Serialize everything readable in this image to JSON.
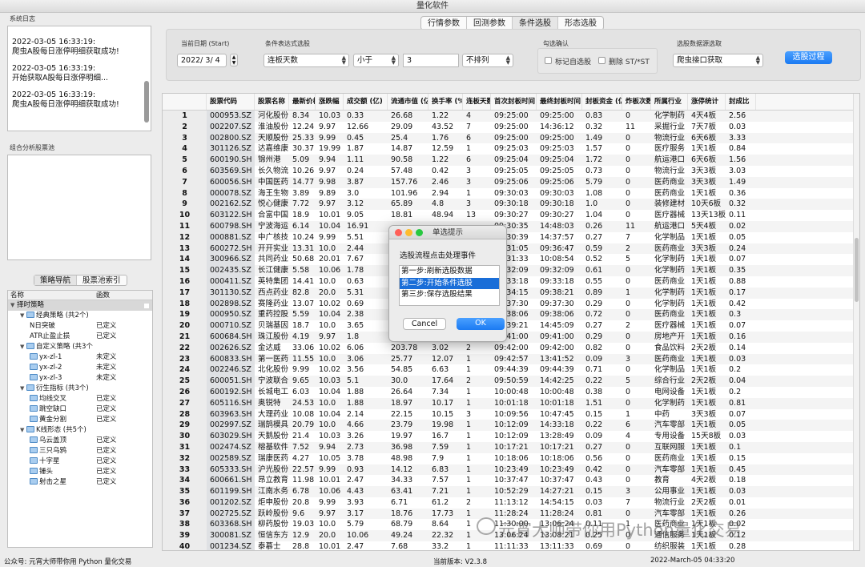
{
  "window": {
    "title": "量化软件"
  },
  "tabs": [
    {
      "label": "行情参数"
    },
    {
      "label": "回测参数"
    },
    {
      "label": "条件选股"
    },
    {
      "label": "形态选股"
    }
  ],
  "system_log": {
    "title": "系统日志",
    "entries": [
      {
        "time": "2022-03-05 16:33:19:",
        "text": "爬虫A股每日涨停明细获取成功!"
      },
      {
        "time": "2022-03-05 16:33:19:",
        "text": "开始获取A股每日涨停明细..."
      },
      {
        "time": "2022-03-05 16:33:19:",
        "text": "爬虫A股每日涨停明细获取成功!"
      }
    ]
  },
  "pool": {
    "title": "组合分析股票池"
  },
  "nav": {
    "tabs": [
      "策略导航",
      "股票池索引"
    ],
    "col_name": "名称",
    "col_func": "函数",
    "items": [
      {
        "label": "择时策略",
        "level": 0,
        "value": "",
        "folder": false,
        "sel": true
      },
      {
        "label": "经典策略 (共2个)",
        "level": 1,
        "value": "",
        "folder": true
      },
      {
        "label": "N日突破",
        "level": 2,
        "value": "已定义",
        "folder": false
      },
      {
        "label": "ATR止盈止损",
        "level": 2,
        "value": "已定义",
        "folder": false
      },
      {
        "label": "自定义策略 (共3个",
        "level": 1,
        "value": "",
        "folder": true
      },
      {
        "label": "yx-zl-1",
        "level": 2,
        "value": "未定义",
        "folder": true
      },
      {
        "label": "yx-zl-2",
        "level": 2,
        "value": "未定义",
        "folder": true
      },
      {
        "label": "yx-zl-3",
        "level": 2,
        "value": "未定义",
        "folder": true
      },
      {
        "label": "衍生指标 (共3个)",
        "level": 1,
        "value": "",
        "folder": true
      },
      {
        "label": "均线交叉",
        "level": 2,
        "value": "已定义",
        "folder": true
      },
      {
        "label": "跳空缺口",
        "level": 2,
        "value": "已定义",
        "folder": true
      },
      {
        "label": "黄金分割",
        "level": 2,
        "value": "已定义",
        "folder": true
      },
      {
        "label": "K线形态 (共5个)",
        "level": 1,
        "value": "",
        "folder": true
      },
      {
        "label": "乌云盖顶",
        "level": 2,
        "value": "已定义",
        "folder": true
      },
      {
        "label": "三只乌鸦",
        "level": 2,
        "value": "已定义",
        "folder": true
      },
      {
        "label": "十字星",
        "level": 2,
        "value": "已定义",
        "folder": true
      },
      {
        "label": "锤头",
        "level": 2,
        "value": "已定义",
        "folder": true
      },
      {
        "label": "射击之星",
        "level": 2,
        "value": "已定义",
        "folder": true
      }
    ]
  },
  "filter": {
    "date_label": "当前日期 (Start)",
    "date_value": "2022/  3/  4",
    "cond_label": "条件表达式选股",
    "cond_field": "连板天数",
    "cond_op": "小于",
    "cond_value": "3",
    "cond_sort": "不排列",
    "check_label": "勾选确认",
    "check1": "标记自选股",
    "check2": "删除 ST/*ST",
    "source_label": "选股数据源选取",
    "source_value": "爬虫接口获取",
    "button": "选股过程"
  },
  "table": {
    "headers": [
      "",
      "股票代码",
      "股票名称",
      "最新价格",
      "涨跌幅",
      "成交额 (亿)",
      "流通市值 (亿)",
      "换手率 (%)",
      "连板天数",
      "首次封板时间",
      "最终封板时间",
      "封板资金 (亿)",
      "炸板次数",
      "所属行业",
      "涨停统计",
      "封成比"
    ],
    "rows": [
      [
        "1",
        "000953.SZ",
        "河化股份",
        "8.34",
        "10.03",
        "0.33",
        "26.68",
        "1.22",
        "4",
        "09:25:00",
        "09:25:00",
        "0.83",
        "0",
        "化学制药",
        "4天4板",
        "2.56"
      ],
      [
        "2",
        "002207.SZ",
        "淮油股份",
        "12.24",
        "9.97",
        "12.66",
        "29.09",
        "43.52",
        "7",
        "09:25:00",
        "14:36:12",
        "0.32",
        "11",
        "采掘行业",
        "7天7板",
        "0.03"
      ],
      [
        "3",
        "002800.SZ",
        "天顺股份",
        "25.33",
        "9.99",
        "0.45",
        "25.4",
        "1.76",
        "6",
        "09:25:00",
        "09:25:00",
        "1.49",
        "0",
        "物流行业",
        "6天6板",
        "3.33"
      ],
      [
        "4",
        "301126.SZ",
        "达嘉维康",
        "30.37",
        "19.99",
        "1.87",
        "14.87",
        "12.59",
        "1",
        "09:25:03",
        "09:25:03",
        "1.57",
        "0",
        "医疗服务",
        "1天1板",
        "0.84"
      ],
      [
        "5",
        "600190.SH",
        "锦州港",
        "5.09",
        "9.94",
        "1.11",
        "90.58",
        "1.22",
        "6",
        "09:25:04",
        "09:25:04",
        "1.72",
        "0",
        "航运港口",
        "6天6板",
        "1.56"
      ],
      [
        "6",
        "603569.SH",
        "长久物流",
        "10.26",
        "9.97",
        "0.24",
        "57.48",
        "0.42",
        "3",
        "09:25:05",
        "09:25:05",
        "0.73",
        "0",
        "物流行业",
        "3天3板",
        "3.03"
      ],
      [
        "7",
        "600056.SH",
        "中国医药",
        "14.77",
        "9.98",
        "3.87",
        "157.76",
        "2.46",
        "3",
        "09:25:06",
        "09:25:06",
        "5.79",
        "0",
        "医药商业",
        "3天3板",
        "1.49"
      ],
      [
        "8",
        "000078.SZ",
        "海王生物",
        "3.89",
        "9.89",
        "3.0",
        "101.96",
        "2.94",
        "1",
        "09:30:03",
        "09:30:03",
        "1.08",
        "0",
        "医药商业",
        "1天1板",
        "0.36"
      ],
      [
        "9",
        "002162.SZ",
        "悦心健康",
        "7.72",
        "9.97",
        "3.12",
        "65.89",
        "4.8",
        "3",
        "09:30:18",
        "09:30:18",
        "1.0",
        "0",
        "装修建材",
        "10天6板",
        "0.32"
      ],
      [
        "10",
        "603122.SH",
        "合富中国",
        "18.9",
        "10.01",
        "9.05",
        "18.81",
        "48.94",
        "13",
        "09:30:27",
        "09:30:27",
        "1.04",
        "0",
        "医疗器械",
        "13天13板",
        "0.11"
      ],
      [
        "11",
        "600798.SH",
        "宁波海运",
        "6.14",
        "10.04",
        "16.91",
        "",
        "",
        "",
        "09:30:35",
        "14:48:03",
        "0.26",
        "11",
        "航运港口",
        "5天4板",
        "0.02"
      ],
      [
        "12",
        "000881.SZ",
        "中广核技",
        "10.24",
        "9.99",
        "5.51",
        "",
        "",
        "",
        "09:30:39",
        "14:37:57",
        "0.27",
        "7",
        "化学制品",
        "1天1板",
        "0.05"
      ],
      [
        "13",
        "600272.SH",
        "开开实业",
        "13.31",
        "10.0",
        "2.44",
        "",
        "",
        "",
        "09:31:05",
        "09:36:47",
        "0.59",
        "2",
        "医药商业",
        "3天3板",
        "0.24"
      ],
      [
        "14",
        "300966.SZ",
        "共同药业",
        "50.68",
        "20.01",
        "7.67",
        "",
        "",
        "",
        "09:31:33",
        "10:08:54",
        "0.52",
        "5",
        "化学制药",
        "1天1板",
        "0.07"
      ],
      [
        "15",
        "002435.SZ",
        "长江健康",
        "5.58",
        "10.06",
        "1.78",
        "",
        "",
        "",
        "09:32:09",
        "09:32:09",
        "0.61",
        "0",
        "化学制药",
        "1天1板",
        "0.35"
      ],
      [
        "16",
        "000411.SZ",
        "英特集团",
        "14.41",
        "10.0",
        "0.63",
        "",
        "",
        "",
        "09:33:18",
        "09:33:18",
        "0.55",
        "0",
        "医药商业",
        "1天1板",
        "0.88"
      ],
      [
        "17",
        "301130.SZ",
        "西点药业",
        "82.8",
        "20.0",
        "5.31",
        "",
        "",
        "",
        "09:34:15",
        "09:38:21",
        "0.89",
        "1",
        "化学制药",
        "1天1板",
        "0.17"
      ],
      [
        "18",
        "002898.SZ",
        "赛隆药业",
        "13.07",
        "10.02",
        "0.69",
        "",
        "",
        "",
        "09:37:30",
        "09:37:30",
        "0.29",
        "0",
        "化学制药",
        "1天1板",
        "0.42"
      ],
      [
        "19",
        "000950.SZ",
        "重药控股",
        "5.59",
        "10.04",
        "2.38",
        "",
        "",
        "",
        "09:38:06",
        "09:38:06",
        "0.72",
        "0",
        "医药商业",
        "1天1板",
        "0.3"
      ],
      [
        "20",
        "000710.SZ",
        "贝瑞基因",
        "18.7",
        "10.0",
        "3.65",
        "",
        "",
        "",
        "09:39:21",
        "14:45:09",
        "0.27",
        "2",
        "医疗器械",
        "1天1板",
        "0.07"
      ],
      [
        "21",
        "600684.SH",
        "珠江股份",
        "4.19",
        "9.97",
        "1.8",
        "",
        "",
        "",
        "09:41:00",
        "09:41:00",
        "0.29",
        "0",
        "房地产开",
        "1天1板",
        "0.16"
      ],
      [
        "22",
        "002626.SZ",
        "金达威",
        "33.06",
        "10.02",
        "6.06",
        "203.78",
        "3.02",
        "2",
        "09:42:00",
        "09:42:00",
        "0.82",
        "0",
        "食品饮料",
        "2天2板",
        "0.14"
      ],
      [
        "23",
        "600833.SH",
        "第一医药",
        "11.55",
        "10.0",
        "3.06",
        "25.77",
        "12.07",
        "1",
        "09:42:57",
        "13:41:52",
        "0.09",
        "3",
        "医药商业",
        "1天1板",
        "0.03"
      ],
      [
        "24",
        "002246.SZ",
        "北化股份",
        "9.99",
        "10.02",
        "3.56",
        "54.85",
        "6.63",
        "1",
        "09:44:39",
        "09:44:39",
        "0.71",
        "0",
        "化学制品",
        "1天1板",
        "0.2"
      ],
      [
        "25",
        "600051.SH",
        "宁波联合",
        "9.65",
        "10.03",
        "5.1",
        "30.0",
        "17.64",
        "2",
        "09:50:59",
        "14:42:25",
        "0.22",
        "5",
        "综合行业",
        "2天2板",
        "0.04"
      ],
      [
        "26",
        "600192.SH",
        "长城电工",
        "6.03",
        "10.04",
        "1.88",
        "26.64",
        "7.34",
        "1",
        "10:00:48",
        "10:00:48",
        "0.38",
        "0",
        "电网设备",
        "1天1板",
        "0.2"
      ],
      [
        "27",
        "605116.SH",
        "奥锐特",
        "24.53",
        "10.0",
        "1.88",
        "18.97",
        "10.17",
        "1",
        "10:01:18",
        "10:01:18",
        "1.51",
        "0",
        "化学制药",
        "1天1板",
        "0.81"
      ],
      [
        "28",
        "603963.SH",
        "大理药业",
        "10.08",
        "10.04",
        "2.14",
        "22.15",
        "10.15",
        "3",
        "10:09:56",
        "10:47:45",
        "0.15",
        "1",
        "中药",
        "3天3板",
        "0.07"
      ],
      [
        "29",
        "002997.SZ",
        "瑞鹄模具",
        "20.79",
        "10.0",
        "4.66",
        "23.79",
        "19.98",
        "1",
        "10:12:09",
        "14:33:18",
        "0.22",
        "6",
        "汽车零部",
        "1天1板",
        "0.05"
      ],
      [
        "30",
        "603029.SH",
        "天鹅股份",
        "21.4",
        "10.03",
        "3.26",
        "19.97",
        "16.7",
        "1",
        "10:12:09",
        "13:28:49",
        "0.09",
        "4",
        "专用设备",
        "15天8板",
        "0.03"
      ],
      [
        "31",
        "002474.SZ",
        "榕基软件",
        "7.52",
        "9.94",
        "2.73",
        "36.98",
        "7.59",
        "1",
        "10:17:21",
        "10:17:21",
        "0.27",
        "0",
        "互联网服",
        "1天1板",
        "0.1"
      ],
      [
        "32",
        "002589.SZ",
        "瑞康医药",
        "4.27",
        "10.05",
        "3.78",
        "48.98",
        "7.9",
        "1",
        "10:18:06",
        "10:18:06",
        "0.56",
        "0",
        "医药商业",
        "1天1板",
        "0.15"
      ],
      [
        "33",
        "605333.SH",
        "沪光股份",
        "22.57",
        "9.99",
        "0.93",
        "14.12",
        "6.83",
        "1",
        "10:23:49",
        "10:23:49",
        "0.42",
        "0",
        "汽车零部",
        "1天1板",
        "0.45"
      ],
      [
        "34",
        "600661.SH",
        "昂立教育",
        "11.98",
        "10.01",
        "2.47",
        "34.33",
        "7.57",
        "1",
        "10:37:47",
        "10:37:47",
        "0.43",
        "0",
        "教育",
        "4天2板",
        "0.18"
      ],
      [
        "35",
        "601199.SH",
        "江南水务",
        "6.78",
        "10.06",
        "4.43",
        "63.41",
        "7.21",
        "1",
        "10:52:29",
        "14:27:21",
        "0.15",
        "3",
        "公用事业",
        "1天1板",
        "0.03"
      ],
      [
        "36",
        "001202.SZ",
        "炬申股份",
        "20.8",
        "9.99",
        "3.93",
        "6.71",
        "61.2",
        "2",
        "11:13:12",
        "14:54:15",
        "0.03",
        "7",
        "物流行业",
        "2天2板",
        "0.01"
      ],
      [
        "37",
        "002725.SZ",
        "跃岭股份",
        "9.6",
        "9.97",
        "3.17",
        "18.76",
        "17.73",
        "1",
        "11:28:24",
        "11:28:24",
        "0.81",
        "0",
        "汽车零部",
        "1天1板",
        "0.26"
      ],
      [
        "38",
        "603368.SH",
        "柳药股份",
        "19.03",
        "10.0",
        "5.79",
        "68.79",
        "8.64",
        "1",
        "11:30:00",
        "13:06:24",
        "0.11",
        "1",
        "医药商业",
        "1天1板",
        "0.02"
      ],
      [
        "39",
        "300081.SZ",
        "恒信东方",
        "12.9",
        "20.0",
        "10.06",
        "49.24",
        "22.32",
        "1",
        "13:06:24",
        "13:08:21",
        "0.25",
        "0",
        "通信服务",
        "1天1板",
        "0.12"
      ],
      [
        "40",
        "001234.SZ",
        "泰慕士",
        "28.8",
        "10.01",
        "2.47",
        "7.68",
        "33.2",
        "1",
        "11:11:33",
        "13:11:33",
        "0.69",
        "0",
        "纺织服装",
        "1天1板",
        "0.28"
      ]
    ]
  },
  "dialog": {
    "title": "单选提示",
    "message": "选股流程点击处理事件",
    "options": [
      "第一步:刷新选股数据",
      "第二步:开始条件选股",
      "第三步:保存选股结果"
    ],
    "selected": 1,
    "cancel": "Cancel",
    "ok": "OK"
  },
  "statusbar": {
    "left": "公众号: 元宵大师带你用 Python 量化交易",
    "version": "当前版本: V2.3.8",
    "datetime": "2022-March-05 04:33:20"
  },
  "watermark": {
    "text": "元宵大师带你用Python量化交易"
  }
}
